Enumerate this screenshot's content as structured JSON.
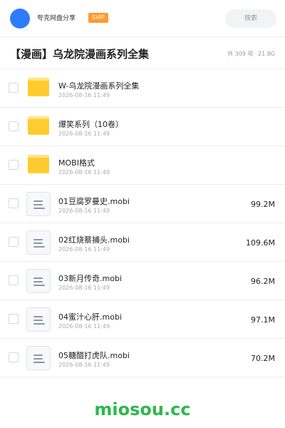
{
  "header": {
    "username": "夸克网盘分享",
    "badge": "SVIP",
    "search_placeholder": "搜索"
  },
  "folder": {
    "title": "【漫画】乌龙院漫画系列全集",
    "count": "共 309 项",
    "separator": "·",
    "total_size": "21.8G"
  },
  "items": [
    {
      "type": "folder",
      "name": "W-乌龙院漫画系列全集",
      "date": "2026-08-16 11:49",
      "size": ""
    },
    {
      "type": "folder",
      "name": "爆笑系列（10卷）",
      "date": "2026-08-16 11:49",
      "size": ""
    },
    {
      "type": "folder",
      "name": "MOBI格式",
      "date": "2026-08-16 11:49",
      "size": ""
    },
    {
      "type": "file",
      "name": "01豆腐罗曼史.mobi",
      "date": "2026-08-16 11:49",
      "size": "99.2M"
    },
    {
      "type": "file",
      "name": "02红烧蔡捕头.mobi",
      "date": "2026-08-16 11:49",
      "size": "109.6M"
    },
    {
      "type": "file",
      "name": "03新月传奇.mobi",
      "date": "2026-08-16 11:49",
      "size": "96.2M"
    },
    {
      "type": "file",
      "name": "04蜜汁心肝.mobi",
      "date": "2026-08-16 11:49",
      "size": "97.1M"
    },
    {
      "type": "file",
      "name": "05糖醋打虎队.mobi",
      "date": "2026-08-16 11:49",
      "size": "70.2M"
    }
  ],
  "watermark": "miosou.cc",
  "icons": {
    "folder": "folder-icon",
    "file": "document-icon"
  },
  "colors": {
    "avatar": "#2f7bff",
    "svip_badge": "#ff9a2e",
    "folder": "#ffcb2e",
    "watermark": "#2db84d"
  }
}
